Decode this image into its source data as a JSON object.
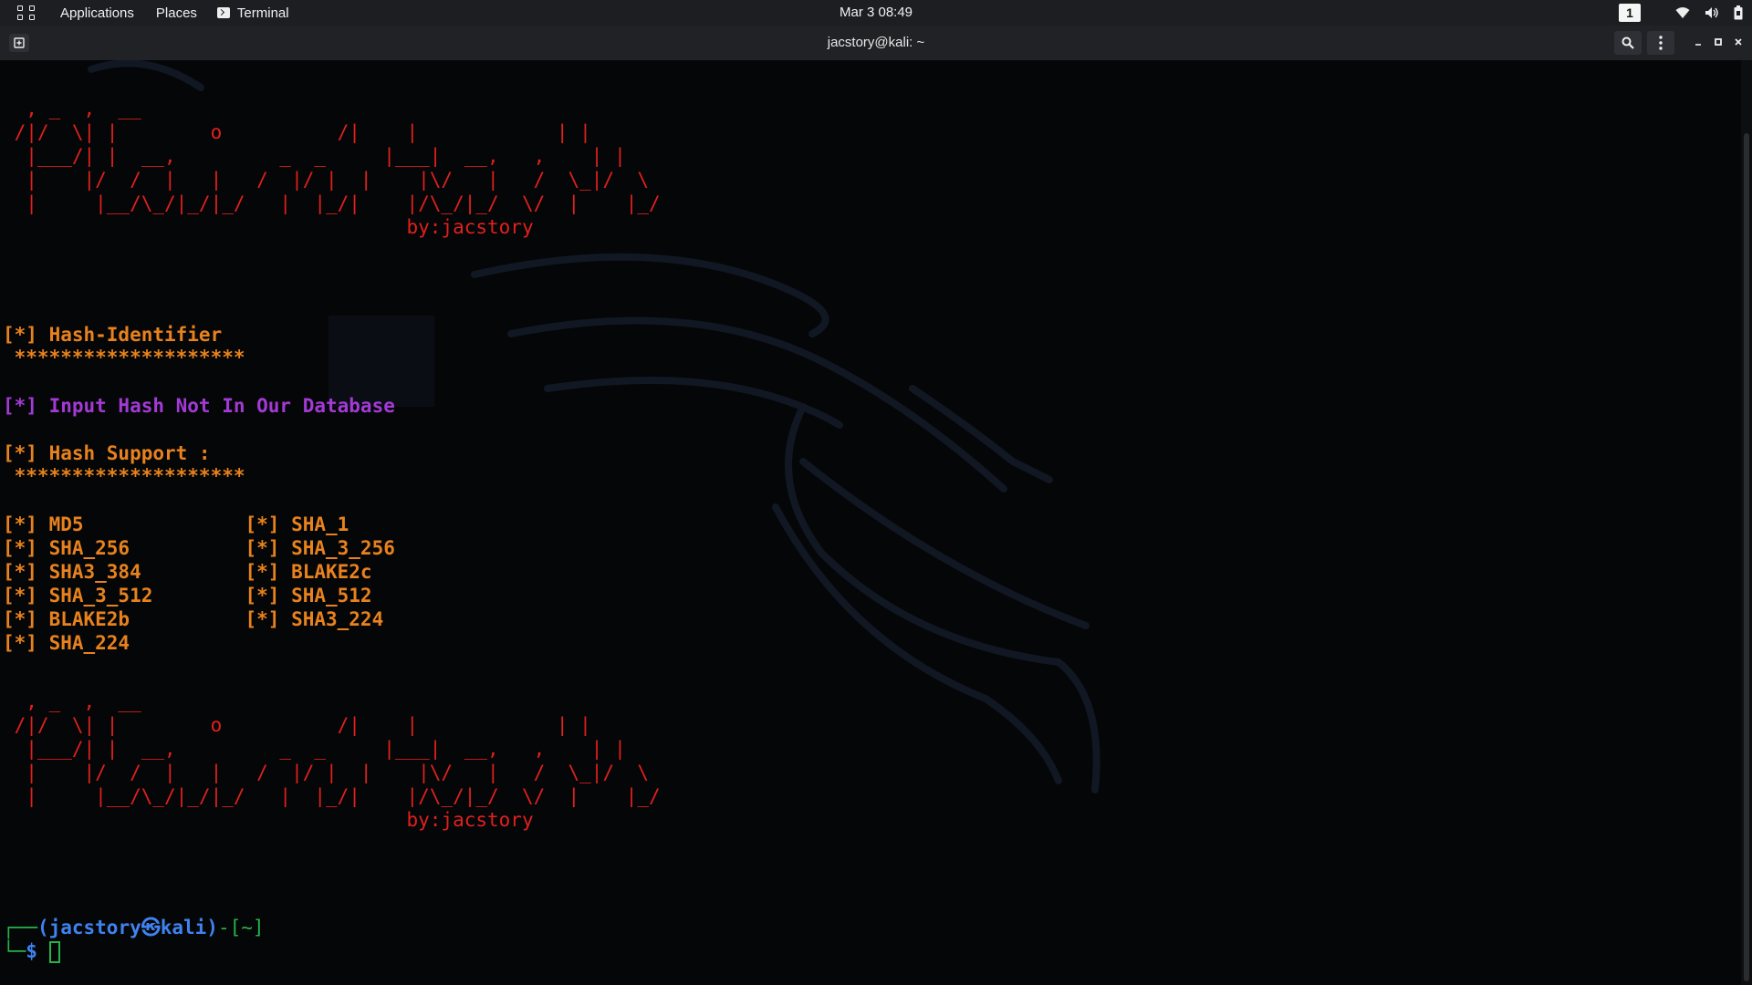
{
  "top_panel": {
    "applications_label": "Applications",
    "places_label": "Places",
    "terminal_label": "Terminal",
    "clock": "Mar 3  08:49",
    "workspace_number": "1"
  },
  "window": {
    "title": "jacstory@kali: ~"
  },
  "terminal": {
    "banner_art": "  , _  ,  __\n /|/  \\| |        o          /|    |            | |\n  |___/| |  __,         _  _     |___|  __,   ,    | |\n  |    |/  /  |   |   /  |/ |  |    |\\/   |   /  \\_|/  \\\n  |     |__/\\_/|_/|_/   |  |_/|    |/\\_/|_/  \\/  |    |_/",
    "banner_byline": "                                   by:jacstory",
    "hash_identifier_title": "[*] Hash-Identifier",
    "stars_line": " ********************",
    "not_in_db_message": "[*] Input Hash Not In Our Database",
    "hash_support_title": "[*] Hash Support :",
    "hash_support_stars": " ********************",
    "hash_rows": [
      "[*] MD5              [*] SHA_1",
      "[*] SHA_256          [*] SHA_3_256",
      "[*] SHA3_384         [*] BLAKE2c",
      "[*] SHA_3_512        [*] SHA_512",
      "[*] BLAKE2b          [*] SHA3_224",
      "[*] SHA_224"
    ],
    "prompt_user_host": "(jacstory㉿kali)",
    "prompt_prefix": "┌──",
    "prompt_dir": "-[~]",
    "prompt_second_prefix": "└─",
    "prompt_symbol": "$"
  },
  "colors": {
    "banner": "#e0201e",
    "text_orange": "#e8821e",
    "text_purple": "#a33ad6",
    "prompt_blue": "#3f82f0",
    "prompt_green": "#27b34b"
  }
}
